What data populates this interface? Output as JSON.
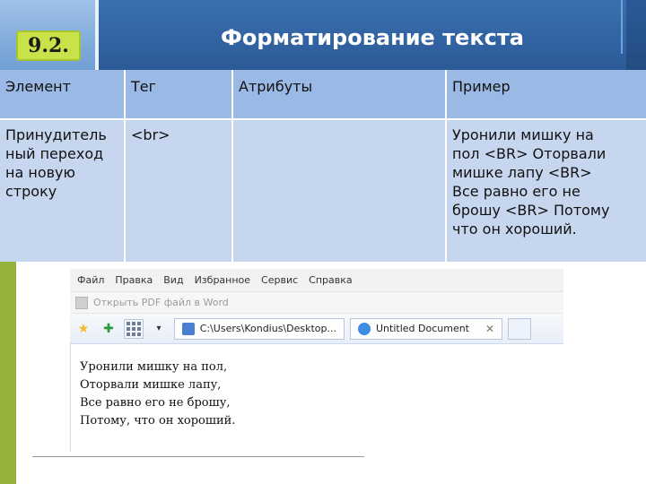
{
  "slide": {
    "number": "9.2.",
    "title": "Форматирование текста"
  },
  "table": {
    "headers": [
      "Элемент",
      "Тег",
      "Атрибуты",
      "Пример"
    ],
    "rows": [
      {
        "element_lines": [
          "Принудитель",
          "ный переход",
          "на новую",
          "строку"
        ],
        "tag": "<br>",
        "attributes": "",
        "example_lines": [
          "Уронили мишку на",
          "пол <BR> Оторвали",
          "мишке лапу <BR>",
          "Все равно его не",
          "брошу <BR> Потому",
          "что он хороший."
        ]
      }
    ]
  },
  "browser": {
    "menu": [
      "Файл",
      "Правка",
      "Вид",
      "Избранное",
      "Сервис",
      "Справка"
    ],
    "pdf_toolbar_label": "Открыть PDF файл в Word",
    "tabs": [
      {
        "label": "C:\\Users\\Kondius\\Desktop...",
        "state": "inactive"
      },
      {
        "label": "Untitled Document",
        "state": "active"
      }
    ],
    "content_lines": [
      "Уронили мишку на пол,",
      "Оторвали мишке лапу,",
      "Все равно его не брошу,",
      "Потому, что он хороший."
    ]
  },
  "colors": {
    "header_blue": "#2c5a97",
    "table_header": "#9bb9e5",
    "table_body": "#c6d6ee",
    "slide_badge": "#c9e24a",
    "green_strip": "#95b33b"
  }
}
